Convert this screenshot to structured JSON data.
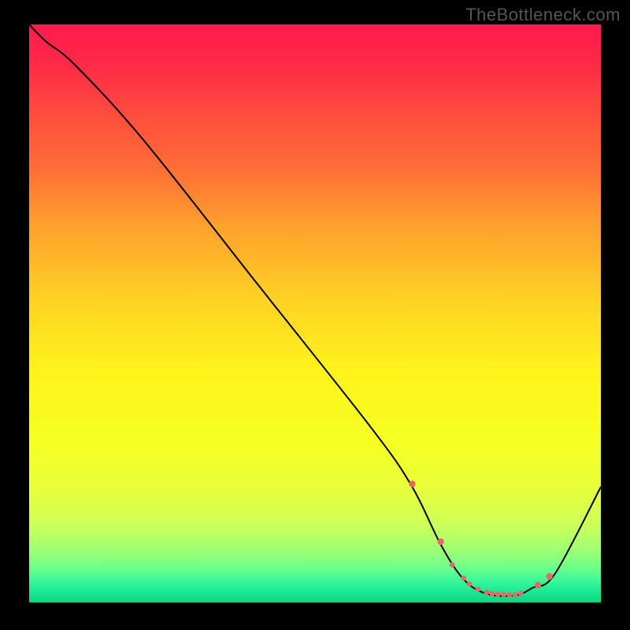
{
  "watermark": "TheBottleneck.com",
  "chart_data": {
    "type": "line",
    "title": "",
    "xlabel": "",
    "ylabel": "",
    "xlim": [
      0,
      100
    ],
    "ylim": [
      0,
      100
    ],
    "grid": false,
    "series": [
      {
        "name": "curve",
        "x": [
          0,
          3,
          8,
          20,
          40,
          60,
          67,
          72,
          76,
          80,
          85,
          88,
          92,
          100
        ],
        "y": [
          100,
          97,
          93,
          80,
          55,
          30,
          20,
          10,
          4,
          1.5,
          1.2,
          2.5,
          5,
          20
        ],
        "stroke": "#000000",
        "stroke_width": 2
      }
    ],
    "markers": {
      "name": "highlight-dots",
      "color": "#e46a6a",
      "x": [
        67,
        72,
        74,
        76,
        77,
        78.5,
        80,
        81,
        82,
        83,
        84,
        85,
        86,
        89,
        91
      ],
      "y": [
        20.5,
        10.5,
        6.5,
        4.2,
        3.2,
        2.3,
        1.7,
        1.5,
        1.4,
        1.35,
        1.3,
        1.3,
        1.6,
        3.0,
        4.5
      ],
      "r": [
        4.2,
        4.2,
        3.4,
        3.4,
        3.4,
        3.4,
        3.4,
        3.4,
        3.4,
        3.4,
        3.4,
        3.4,
        3.4,
        4.2,
        4.2
      ]
    },
    "background_gradient": {
      "type": "vertical",
      "stops": [
        {
          "pos": 0.0,
          "color": "#ff1a4e"
        },
        {
          "pos": 0.07,
          "color": "#ff2a47"
        },
        {
          "pos": 0.15,
          "color": "#ff4a3e"
        },
        {
          "pos": 0.25,
          "color": "#ff6e36"
        },
        {
          "pos": 0.35,
          "color": "#ffa12d"
        },
        {
          "pos": 0.48,
          "color": "#ffd324"
        },
        {
          "pos": 0.6,
          "color": "#fff31c"
        },
        {
          "pos": 0.72,
          "color": "#f6ff22"
        },
        {
          "pos": 0.8,
          "color": "#e9ff3a"
        },
        {
          "pos": 0.86,
          "color": "#d0ff55"
        },
        {
          "pos": 0.905,
          "color": "#a6ff70"
        },
        {
          "pos": 0.94,
          "color": "#6dff8a"
        },
        {
          "pos": 0.965,
          "color": "#35f79b"
        },
        {
          "pos": 0.985,
          "color": "#17e58f"
        },
        {
          "pos": 1.0,
          "color": "#0fd47f"
        }
      ]
    }
  }
}
